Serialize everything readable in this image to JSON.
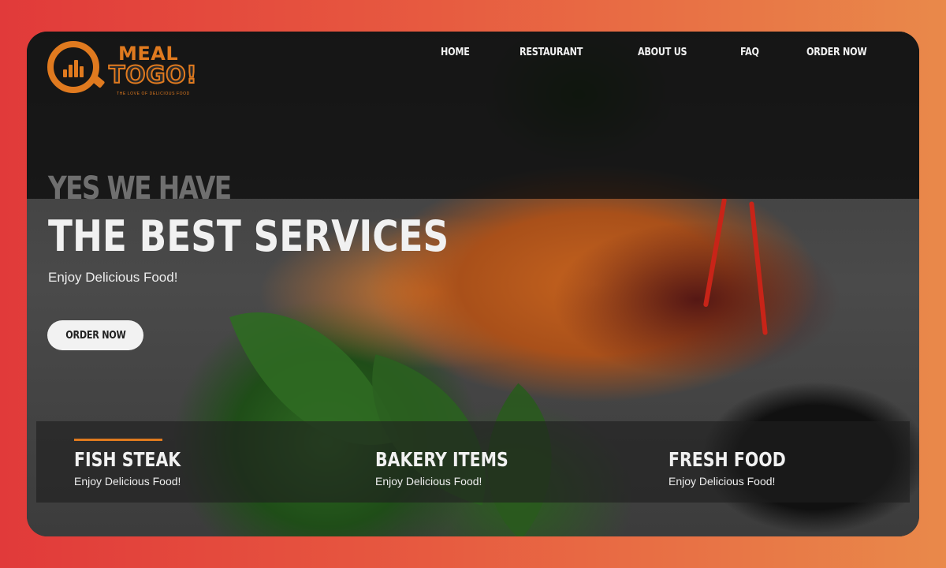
{
  "brand": {
    "line1": "MEAL",
    "line2": "TOGO!",
    "tagline": "THE LOVE OF DELICIOUS FOOD",
    "accent_color": "#e07a1f"
  },
  "nav": {
    "items": [
      {
        "label": "HOME"
      },
      {
        "label": "RESTAURANT"
      },
      {
        "label": "ABOUT US"
      },
      {
        "label": "FAQ"
      },
      {
        "label": "ORDER NOW"
      }
    ]
  },
  "hero": {
    "kicker": "YES WE HAVE",
    "headline": "THE BEST SERVICES",
    "tagline": "Enjoy Delicious Food!",
    "cta_label": "ORDER NOW"
  },
  "features": [
    {
      "title": "FISH STEAK",
      "subtitle": "Enjoy Delicious Food!"
    },
    {
      "title": "BAKERY ITEMS",
      "subtitle": "Enjoy Delicious Food!"
    },
    {
      "title": "FRESH FOOD",
      "subtitle": "Enjoy Delicious Food!"
    }
  ]
}
